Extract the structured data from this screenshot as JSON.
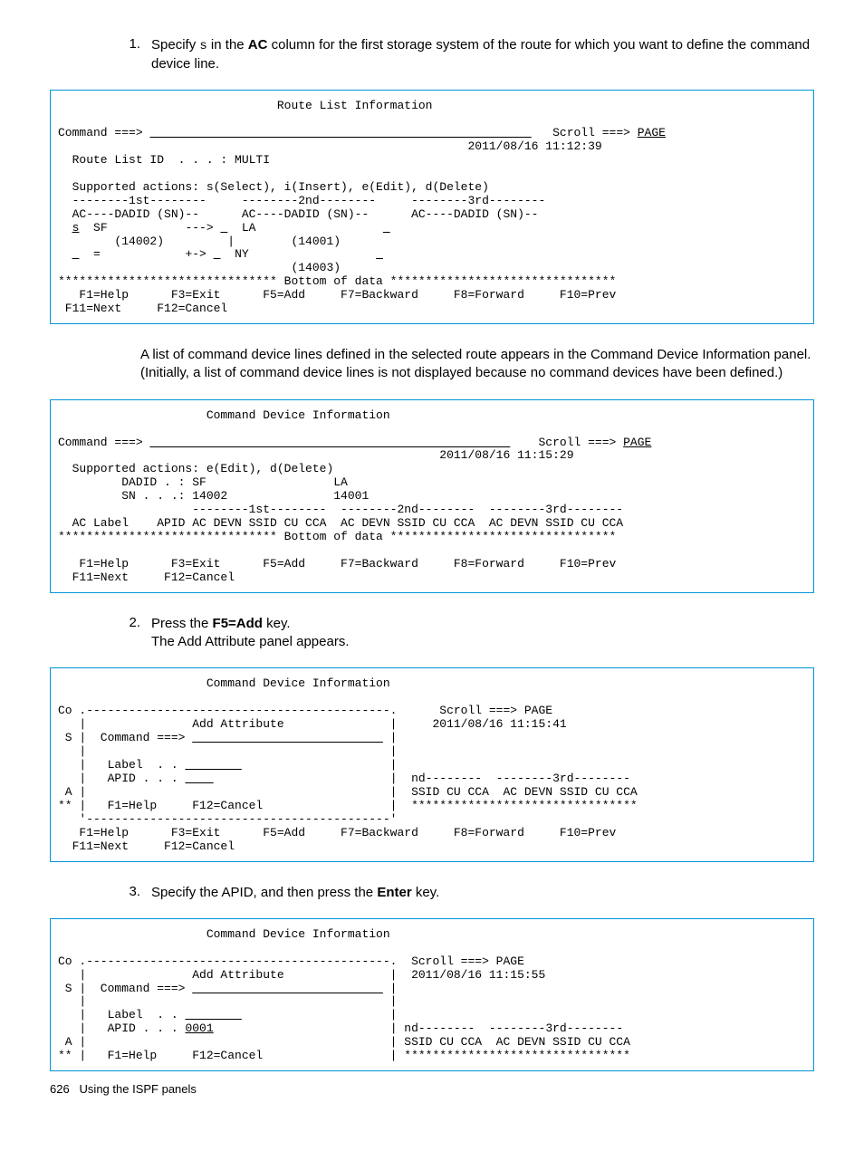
{
  "steps": {
    "s1_num": "1.",
    "s1_a": "Specify ",
    "s1_code": "s",
    "s1_b": " in the ",
    "s1_bold": "AC",
    "s1_c": " column for the first storage system of the route for which you want to define the command device line.",
    "s2_num": "2.",
    "s2_a": "Press the ",
    "s2_bold": "F5=Add",
    "s2_b": " key.",
    "s2_line2": "The Add Attribute panel appears.",
    "s3_num": "3.",
    "s3_a": "Specify the APID, and then press the ",
    "s3_bold": "Enter",
    "s3_b": " key."
  },
  "panel1": {
    "l01": "                               Route List Information",
    "l02": "",
    "l03a": "Command ===> ",
    "l03u": "                                                      ",
    "l03b": "   Scroll ===> ",
    "l03p": "PAGE",
    "l04": "                                                          2011/08/16 11:12:39",
    "l05": "  Route List ID  . . . : MULTI",
    "l06": "",
    "l07": "  Supported actions: s(Select), i(Insert), e(Edit), d(Delete)",
    "l08": "  --------1st--------     --------2nd--------     --------3rd--------",
    "l09": "  AC----DADID (SN)--      AC----DADID (SN)--      AC----DADID (SN)--",
    "l10a": "  ",
    "l10s": "s",
    "l10b": "  SF           ---> ",
    "l10u": " ",
    "l10c": "  LA                  ",
    "l10u2": " ",
    "l11": "        (14002)         |        (14001)",
    "l12a": "  ",
    "l12u": " ",
    "l12b": "  =            +-> ",
    "l12u2": " ",
    "l12c": "  NY                  ",
    "l12u3": " ",
    "l13": "                                 (14003)",
    "l14": "******************************* Bottom of data ********************************",
    "l15": "   F1=Help      F3=Exit      F5=Add     F7=Backward     F8=Forward     F10=Prev",
    "l16": " F11=Next     F12=Cancel"
  },
  "para1": "A list of command device lines defined in the selected route appears in the Command Device Information panel. (Initially, a list of command device lines is not displayed because no command devices have been defined.)",
  "panel2": {
    "l01": "                     Command Device Information",
    "l02": "",
    "l03a": "Command ===> ",
    "l03u": "                                                   ",
    "l03b": "    Scroll ===> ",
    "l03p": "PAGE",
    "l04": "                                                      2011/08/16 11:15:29",
    "l05": "  Supported actions: e(Edit), d(Delete)",
    "l06": "         DADID . : SF                  LA",
    "l07": "         SN . . .: 14002               14001",
    "l08": "                   --------1st--------  --------2nd--------  --------3rd--------",
    "l09": "  AC Label    APID AC DEVN SSID CU CCA  AC DEVN SSID CU CCA  AC DEVN SSID CU CCA",
    "l10": "******************************* Bottom of data ********************************",
    "l11": "",
    "l12": "   F1=Help      F3=Exit      F5=Add     F7=Backward     F8=Forward     F10=Prev",
    "l13": "  F11=Next     F12=Cancel"
  },
  "panel3": {
    "l01": "                     Command Device Information",
    "l02": "",
    "l03": "Co .-------------------------------------------.      Scroll ===> PAGE",
    "l04": "   |               Add Attribute               |     2011/08/16 11:15:41",
    "l05a": " S |  Command ===> ",
    "l05u": "                           ",
    "l05b": " |",
    "l06": "   |                                           |",
    "l07a": "   |   Label  . . ",
    "l07u": "        ",
    "l07b": "                     |",
    "l08a": "   |   APID . . . ",
    "l08u": "    ",
    "l08b": "                         |  nd--------  --------3rd--------",
    "l09": " A |                                           |  SSID CU CCA  AC DEVN SSID CU CCA",
    "l10": "** |   F1=Help     F12=Cancel                  |  ********************************",
    "l11": "   '-------------------------------------------'",
    "l12": "   F1=Help      F3=Exit      F5=Add     F7=Backward     F8=Forward     F10=Prev",
    "l13": "  F11=Next     F12=Cancel"
  },
  "panel4": {
    "l01": "                     Command Device Information",
    "l02": "",
    "l03": "Co .-------------------------------------------.  Scroll ===> PAGE",
    "l04": "   |               Add Attribute               |  2011/08/16 11:15:55",
    "l05a": " S |  Command ===> ",
    "l05u": "                           ",
    "l05b": " |",
    "l06": "   |                                           |",
    "l07a": "   |   Label  . . ",
    "l07u": "        ",
    "l07b": "                     |",
    "l08a": "   |   APID . . . ",
    "l08v": "0001",
    "l08b": "                         | nd--------  --------3rd--------",
    "l09": " A |                                           | SSID CU CCA  AC DEVN SSID CU CCA",
    "l10": "** |   F1=Help     F12=Cancel                  | ********************************"
  },
  "footer": {
    "page": "626",
    "title": "Using the ISPF panels"
  }
}
